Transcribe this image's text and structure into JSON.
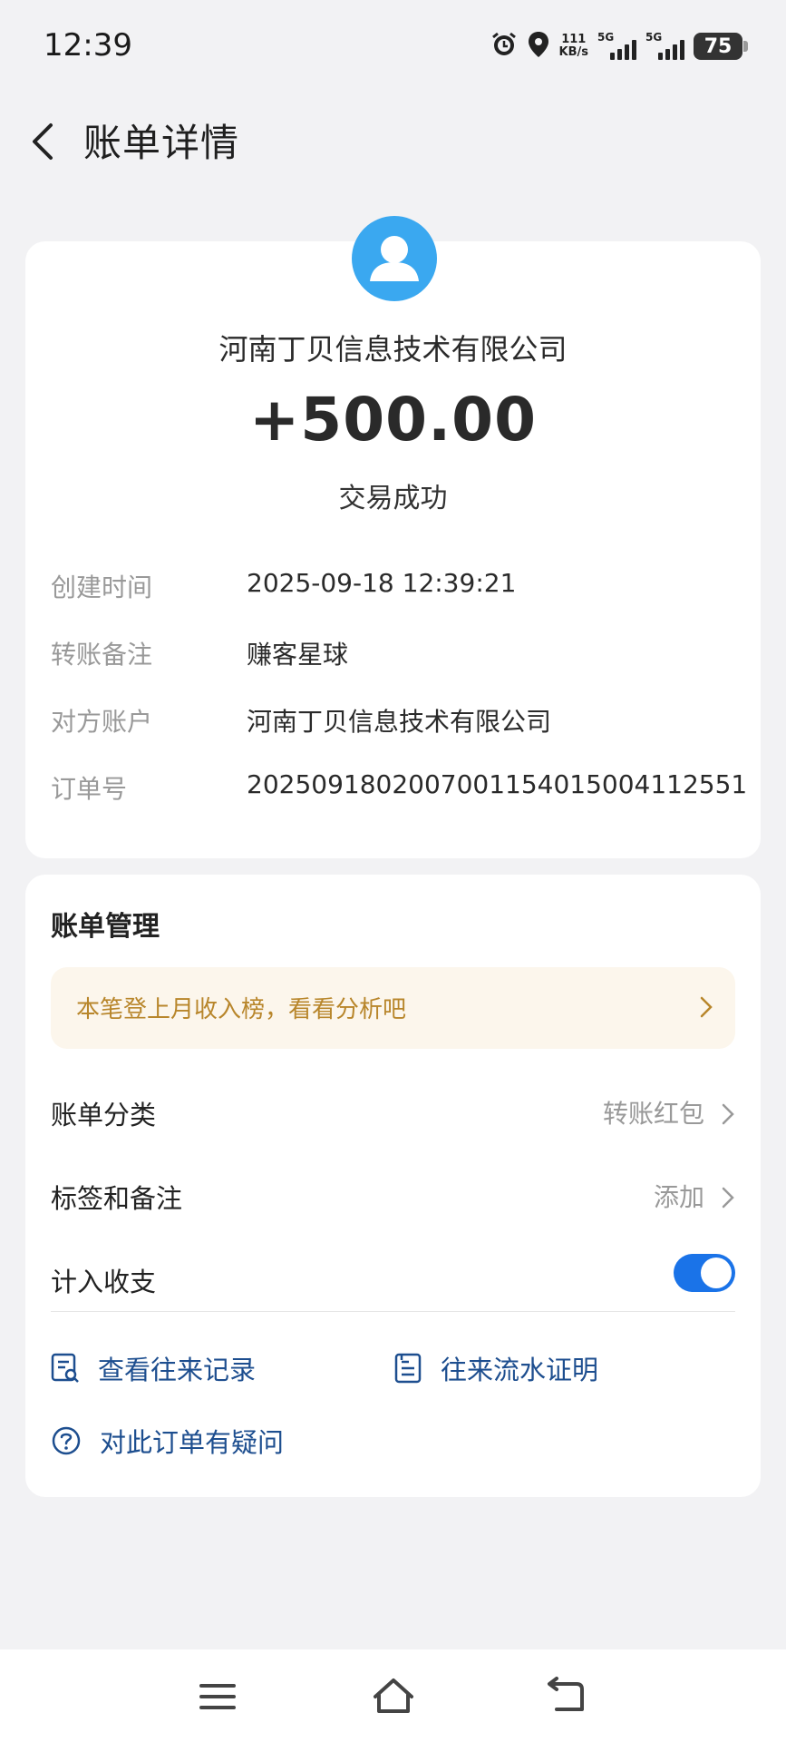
{
  "status_bar": {
    "time": "12:39",
    "net_speed_value": "111",
    "net_speed_unit": "KB/s",
    "signal1_label": "5G",
    "signal2_label": "5G",
    "battery": "75"
  },
  "header": {
    "title": "账单详情",
    "back_icon": "chevron-left-icon"
  },
  "summary": {
    "counterparty": "河南丁贝信息技术有限公司",
    "amount": "+500.00",
    "status": "交易成功"
  },
  "details": [
    {
      "label": "创建时间",
      "value": "2025-09-18 12:39:21"
    },
    {
      "label": "转账备注",
      "value": "赚客星球"
    },
    {
      "label": "对方账户",
      "value": "河南丁贝信息技术有限公司"
    },
    {
      "label": "订单号",
      "value": "2025091802007001154015004112551"
    }
  ],
  "management": {
    "title": "账单管理",
    "tip": "本笔登上月收入榜，看看分析吧",
    "category_label": "账单分类",
    "category_value": "转账红包",
    "tags_label": "标签和备注",
    "tags_value": "添加",
    "include_label": "计入收支",
    "include_enabled": true,
    "link_history": "查看往来记录",
    "link_proof": "往来流水证明",
    "link_question": "对此订单有疑问"
  },
  "colors": {
    "accent": "#1a73e8",
    "link": "#1d4e8f",
    "tip_bg": "#fcf6ec",
    "tip_text": "#b8862b",
    "avatar": "#3aa8f0"
  }
}
